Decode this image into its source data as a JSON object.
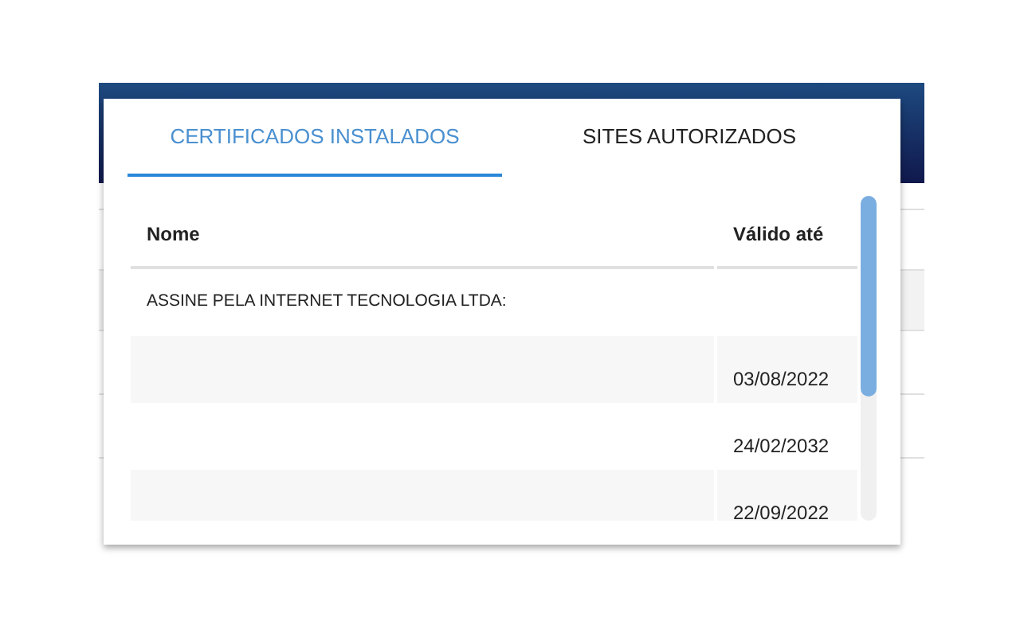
{
  "tabs": [
    {
      "label": "CERTIFICADOS INSTALADOS",
      "selected": true
    },
    {
      "label": "SITES AUTORIZADOS",
      "selected": false
    }
  ],
  "table": {
    "columns": [
      "Nome",
      "Válido até"
    ],
    "rows": [
      {
        "name": "ASSINE PELA INTERNET TECNOLOGIA LTDA:"
      },
      {
        "valid_until": "03/08/2022"
      },
      {
        "valid_until": "24/02/2032"
      },
      {
        "valid_until": "22/09/2022"
      }
    ]
  }
}
